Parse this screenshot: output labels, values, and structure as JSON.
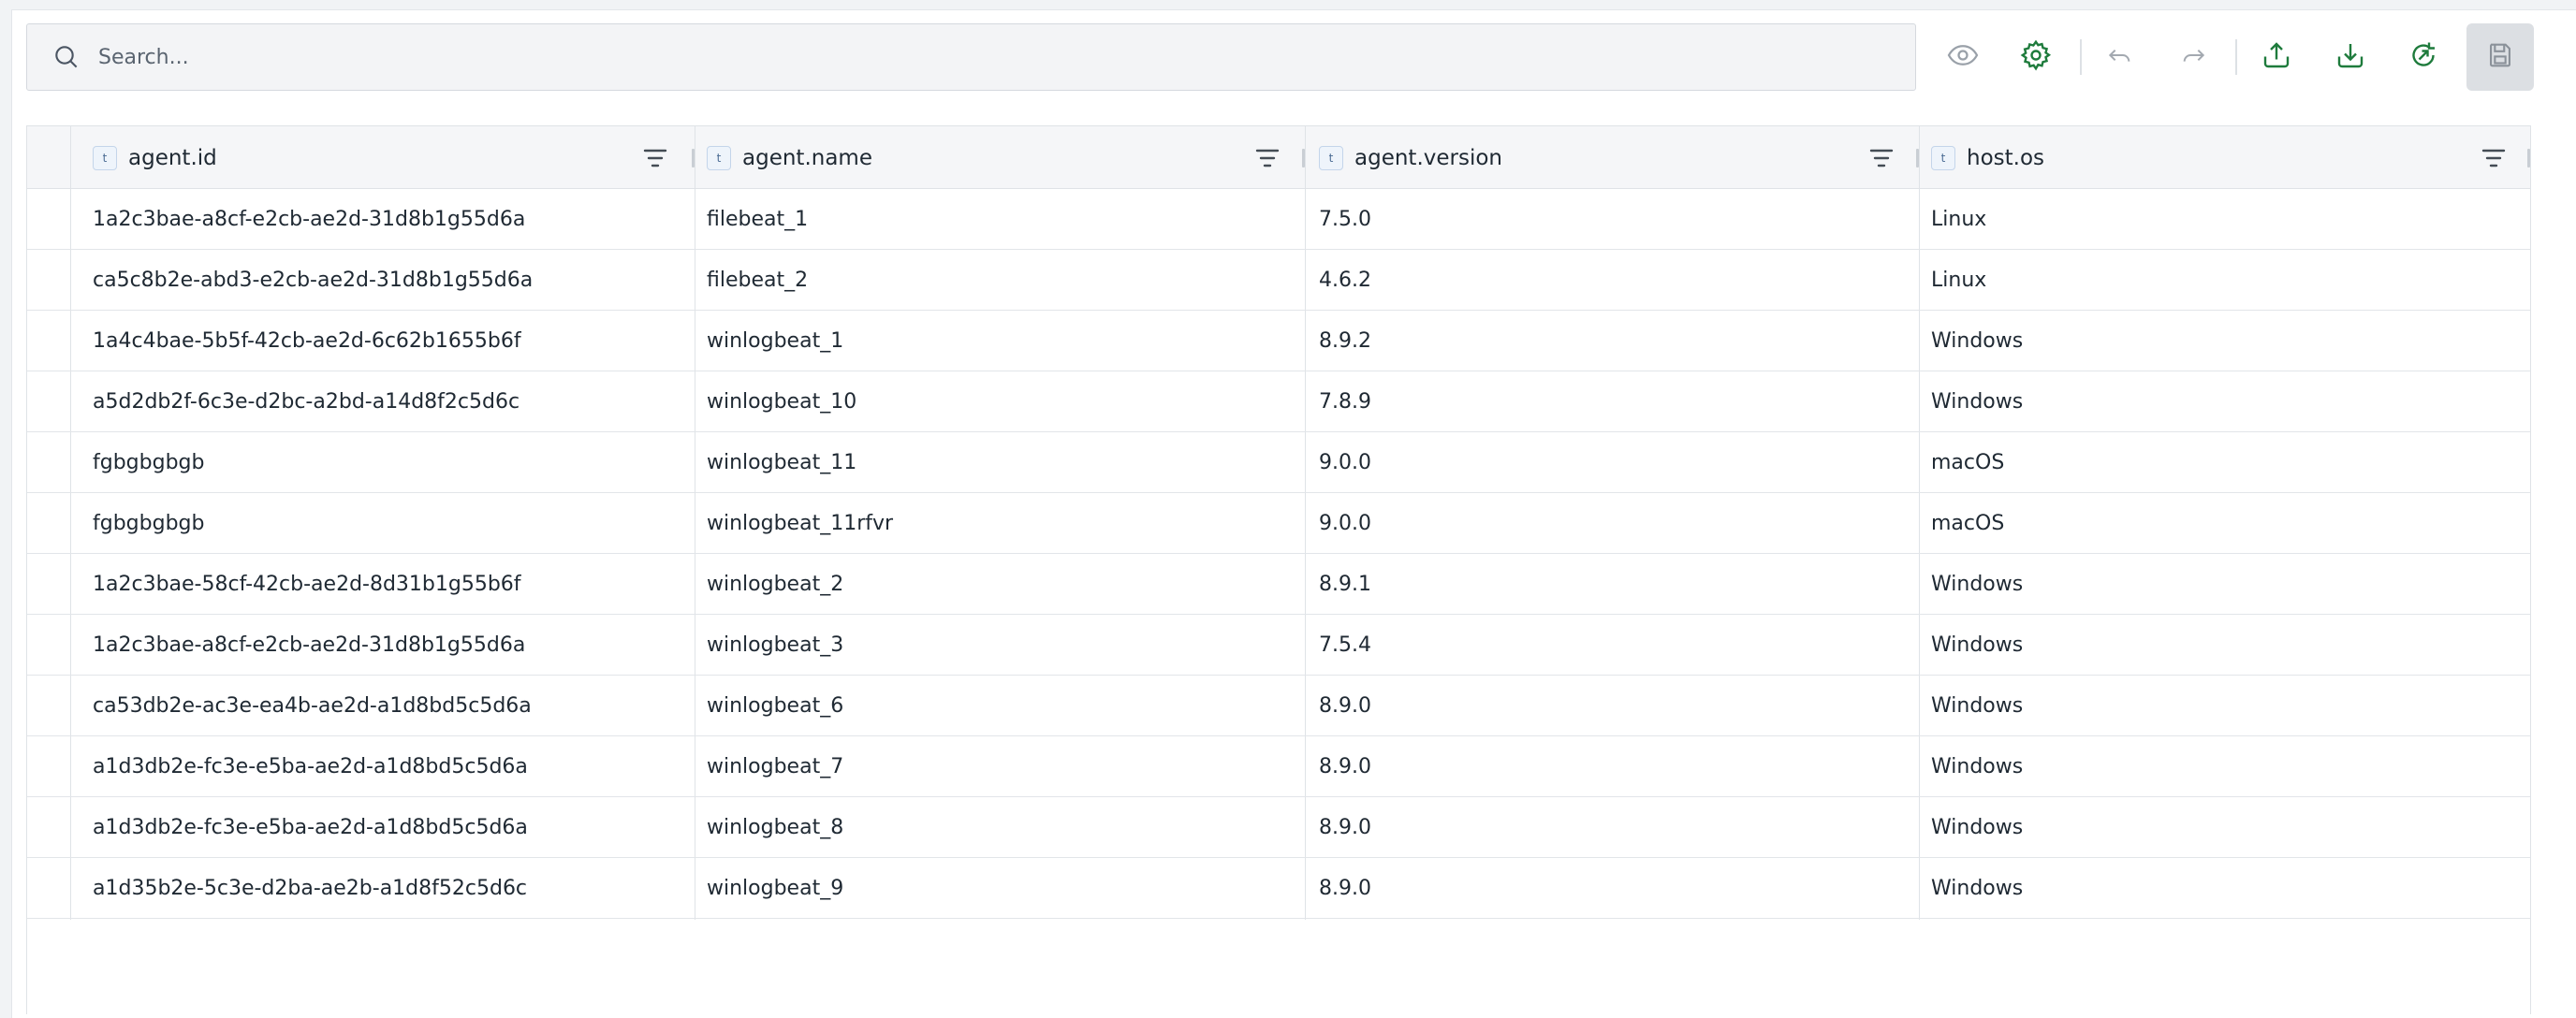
{
  "toolbar": {
    "search_placeholder": "Search...",
    "icons": [
      "search-icon",
      "eye-icon",
      "gear-icon",
      "undo-icon",
      "redo-icon",
      "upload-icon",
      "download-icon",
      "refresh-icon",
      "save-icon"
    ],
    "accent_color": "#1e7b3c"
  },
  "table": {
    "columns": [
      {
        "type": "t",
        "label": "agent.id"
      },
      {
        "type": "t",
        "label": "agent.name"
      },
      {
        "type": "t",
        "label": "agent.version"
      },
      {
        "type": "t",
        "label": "host.os"
      }
    ],
    "rows": [
      [
        "1a2c3bae-a8cf-e2cb-ae2d-31d8b1g55d6a",
        "filebeat_1",
        "7.5.0",
        "Linux"
      ],
      [
        "ca5c8b2e-abd3-e2cb-ae2d-31d8b1g55d6a",
        "filebeat_2",
        "4.6.2",
        "Linux"
      ],
      [
        "1a4c4bae-5b5f-42cb-ae2d-6c62b1655b6f",
        "winlogbeat_1",
        "8.9.2",
        "Windows"
      ],
      [
        "a5d2db2f-6c3e-d2bc-a2bd-a14d8f2c5d6c",
        "winlogbeat_10",
        "7.8.9",
        "Windows"
      ],
      [
        "fgbgbgbgb",
        "winlogbeat_11",
        "9.0.0",
        "macOS"
      ],
      [
        "fgbgbgbgb",
        "winlogbeat_11rfvr",
        "9.0.0",
        "macOS"
      ],
      [
        "1a2c3bae-58cf-42cb-ae2d-8d31b1g55b6f",
        "winlogbeat_2",
        "8.9.1",
        "Windows"
      ],
      [
        "1a2c3bae-a8cf-e2cb-ae2d-31d8b1g55d6a",
        "winlogbeat_3",
        "7.5.4",
        "Windows"
      ],
      [
        "ca53db2e-ac3e-ea4b-ae2d-a1d8bd5c5d6a",
        "winlogbeat_6",
        "8.9.0",
        "Windows"
      ],
      [
        "a1d3db2e-fc3e-e5ba-ae2d-a1d8bd5c5d6a",
        "winlogbeat_7",
        "8.9.0",
        "Windows"
      ],
      [
        "a1d3db2e-fc3e-e5ba-ae2d-a1d8bd5c5d6a",
        "winlogbeat_8",
        "8.9.0",
        "Windows"
      ],
      [
        "a1d35b2e-5c3e-d2ba-ae2b-a1d8f52c5d6c",
        "winlogbeat_9",
        "8.9.0",
        "Windows"
      ]
    ]
  }
}
